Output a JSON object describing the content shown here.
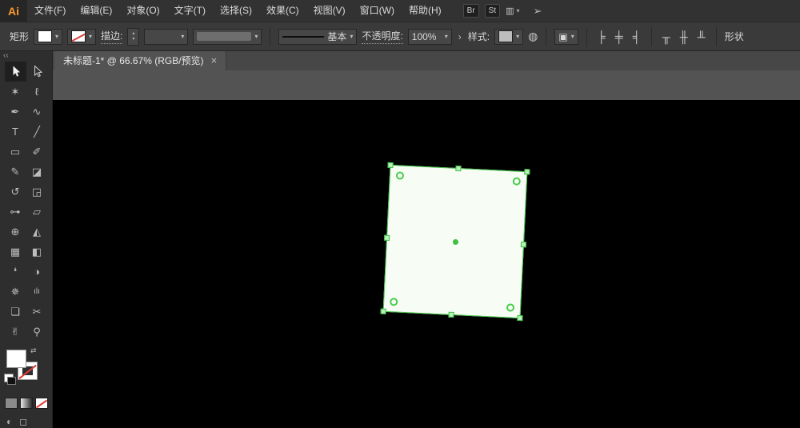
{
  "app": {
    "logo_text": "Ai"
  },
  "menubar": {
    "items": [
      "文件(F)",
      "编辑(E)",
      "对象(O)",
      "文字(T)",
      "选择(S)",
      "效果(C)",
      "视图(V)",
      "窗口(W)",
      "帮助(H)"
    ],
    "bridge_label": "Br",
    "stock_label": "St"
  },
  "controlbar": {
    "tool_label": "矩形",
    "stroke_label": "描边:",
    "brush_style": "基本",
    "opacity_label": "不透明度:",
    "opacity_value": "100%",
    "style_label": "样式:",
    "shape_label": "形状"
  },
  "tabbar": {
    "title": "未标题-1* @ 66.67%  (RGB/预览)",
    "close_icon": "×"
  },
  "toolbar": {
    "collapse_icon": "‹‹",
    "tools": [
      {
        "name": "selection",
        "glyph": ""
      },
      {
        "name": "direct-selection",
        "glyph": ""
      },
      {
        "name": "magic-wand",
        "glyph": "✶"
      },
      {
        "name": "lasso",
        "glyph": "ℓ"
      },
      {
        "name": "pen",
        "glyph": "✒"
      },
      {
        "name": "curvature",
        "glyph": "∿"
      },
      {
        "name": "type",
        "glyph": "T"
      },
      {
        "name": "line-segment",
        "glyph": "╱"
      },
      {
        "name": "rectangle",
        "glyph": "▭"
      },
      {
        "name": "paintbrush",
        "glyph": "✐"
      },
      {
        "name": "pencil",
        "glyph": "✎"
      },
      {
        "name": "eraser",
        "glyph": "◪"
      },
      {
        "name": "rotate",
        "glyph": "↺"
      },
      {
        "name": "scale",
        "glyph": "◲"
      },
      {
        "name": "width",
        "glyph": "⊶"
      },
      {
        "name": "free-transform",
        "glyph": "▱"
      },
      {
        "name": "shape-builder",
        "glyph": "⊕"
      },
      {
        "name": "perspective-grid",
        "glyph": "◭"
      },
      {
        "name": "mesh",
        "glyph": "▦"
      },
      {
        "name": "gradient",
        "glyph": "◧"
      },
      {
        "name": "eyedropper",
        "glyph": "❛"
      },
      {
        "name": "blend",
        "glyph": "◑"
      },
      {
        "name": "symbol-sprayer",
        "glyph": "✵"
      },
      {
        "name": "column-graph",
        "glyph": "ılı"
      },
      {
        "name": "artboard",
        "glyph": "❏"
      },
      {
        "name": "slice",
        "glyph": "✂"
      },
      {
        "name": "hand",
        "glyph": "✌"
      },
      {
        "name": "zoom",
        "glyph": "⚲"
      }
    ],
    "fill_color": "#FFFFFF",
    "stroke_color": "none"
  },
  "canvas": {
    "selection": {
      "fill_color": "#F7FDF4",
      "accent_color": "#46C94A"
    }
  },
  "icons": {
    "caret": "▾",
    "spin_up": "▴",
    "spin_down": "▾",
    "chevron": "›",
    "swap": "⇄",
    "workspace": "▥",
    "share": "➢",
    "recolor": "◍",
    "transform": "▣",
    "align_h_left": "╞",
    "align_h_center": "╪",
    "align_h_right": "╡",
    "align_v_top": "╥",
    "align_v_center": "╫",
    "align_v_bottom": "╨",
    "drawing_mode": "◐",
    "screen_mode": "◻"
  }
}
